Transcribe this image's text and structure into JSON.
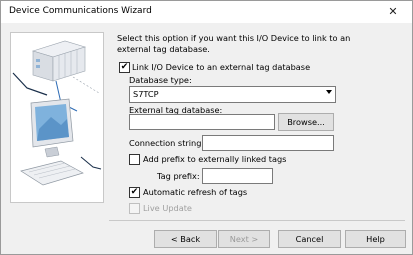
{
  "window": {
    "title": "Device Communications Wizard"
  },
  "description": "Select this option if you want this I/O Device to link to an external tag database.",
  "link": {
    "label": "Link I/O Device to an external tag database",
    "checked": true
  },
  "database_type": {
    "label": "Database type:",
    "value": "S7TCP"
  },
  "external_db": {
    "label": "External tag database:",
    "value": "",
    "browse_label": "Browse..."
  },
  "connection": {
    "label": "Connection string:",
    "value": ""
  },
  "prefix": {
    "label": "Add prefix to externally linked tags",
    "checked": false
  },
  "tag_prefix": {
    "label": "Tag prefix:",
    "value": ""
  },
  "auto_refresh": {
    "label": "Automatic refresh of tags",
    "checked": true
  },
  "live_update": {
    "label": "Live Update",
    "checked": false,
    "enabled": false
  },
  "buttons": {
    "back": "< Back",
    "next": "Next >",
    "cancel": "Cancel",
    "help": "Help"
  }
}
